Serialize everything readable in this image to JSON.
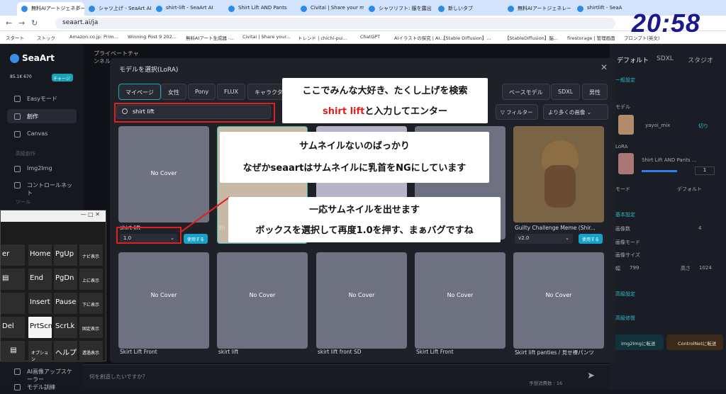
{
  "browser": {
    "tabs": [
      "無料AIアートジェネレーター",
      "シャツ上げ - SeaArt AI",
      "shirt-lift - SeaArt AI",
      "Shirt Lift AND Pants",
      "Civitai | Share your m",
      "シャツリフト: 服を露出させ",
      "新しいタブ",
      "無料AIアートジェネレーター",
      "shirtlift - SeaArt AI M"
    ],
    "url": "seaart.ai/ja",
    "bookmarks": [
      "スタート",
      "ストック",
      "Amazon.co.jp: Prim...",
      "Winning Post 9 202...",
      "無料AIアート生成器 -...",
      "Civitai | Share your...",
      "トレンド | chichi-pui...",
      "ChatGPT",
      "AIイラストの探究 | AI...",
      "【Stable Diffusion】...",
      "【StableDiffusion】脳...",
      "firestorage | 管理画面",
      "プロンプト(英文)"
    ],
    "clock": "20:58"
  },
  "sidebar": {
    "brand": "SeaArt",
    "credits": "85.1K   670",
    "charge": "チャージ",
    "items": [
      "Easyモード",
      "創作",
      "Canvas",
      "高級創作",
      "Img2Img",
      "コントロールネット",
      "ツール"
    ],
    "footer": [
      "AI画像アップスケーラー",
      "モデル訓練"
    ]
  },
  "keyboard": {
    "title": "—   □   ✕",
    "keys": [
      "Home",
      "PgUp",
      "ナビ表示",
      "End",
      "PgDn",
      "上に表示",
      "Insert",
      "Pause",
      "下に表示",
      "Del",
      "PrtScn",
      "ScrLk",
      "固定表示",
      "オプション",
      "ヘルプ",
      "透過表示",
      "回",
      "er",
      "▤"
    ]
  },
  "main": {
    "tab_title": "プライベートチャンネル",
    "side_item": "S"
  },
  "modal": {
    "title": "モデルを選択(LoRA)",
    "close": "✕",
    "categories": [
      "マイページ",
      "女性",
      "Pony",
      "FLUX",
      "キャラクター",
      "ベースモデル",
      "SDXL",
      "男性"
    ],
    "search_value": "shirt lift",
    "filter": "フィルター",
    "more_images": "より多くの画像",
    "cards_row1": [
      {
        "name": "shirt-lift",
        "version": "1.0",
        "use": "使用する",
        "cover": "No Cover"
      },
      {
        "name": "Sh",
        "version": "",
        "use": "",
        "cover": ""
      },
      {
        "name": "",
        "version": "",
        "use": "",
        "cover": ""
      },
      {
        "name": "",
        "version": "",
        "use": "",
        "cover": ""
      },
      {
        "name": "Guilty Challenge Meme (Shir...",
        "version": "v2.0",
        "use": "使用する",
        "cover": ""
      }
    ],
    "cards_row2": [
      {
        "name": "Skirt Lift Front",
        "cover": "No Cover"
      },
      {
        "name": "skirt lift",
        "cover": "No Cover"
      },
      {
        "name": "skirt lift front SD",
        "cover": "No Cover"
      },
      {
        "name": "Skirt Lift Front",
        "cover": "No Cover"
      },
      {
        "name": "Skirt lift panties / 見せ裸パンツ",
        "cover": "No Cover"
      }
    ]
  },
  "annotations": {
    "a1_line1": "ここでみんな大好き、たくし上げを検索",
    "a1_line2_red": "shirt lift",
    "a1_line2": "と入力してエンター",
    "a2_line1": "サムネイルないのばっかり",
    "a2_line2": "なぜかseaartはサムネイルに乳首をNGにしています",
    "a3_line1": "一応サムネイルを出せます",
    "a3_line2": "ボックスを選択して再度1.0を押す、まぁバグですね"
  },
  "right_panel": {
    "tabs": [
      "デフォルト",
      "SDXL",
      "スタジオ"
    ],
    "labels": [
      "ー般設定",
      "モデル",
      "yayoi_mix",
      "切り",
      "LoRA",
      "Shirt Lift AND Pants ...",
      "1",
      "モード",
      "デフォルト",
      "基本設定",
      "画像数",
      "画像モード",
      "画像サイズ",
      "幅",
      "799",
      "高さ",
      "1024",
      "高級設定",
      "高級修復",
      "4"
    ],
    "buttons": [
      "Img2Imgに転送",
      "ControlNetに転送"
    ]
  },
  "chat": {
    "placeholder": "何を創造したいですか？",
    "cost": "予想消費数 : 16"
  }
}
